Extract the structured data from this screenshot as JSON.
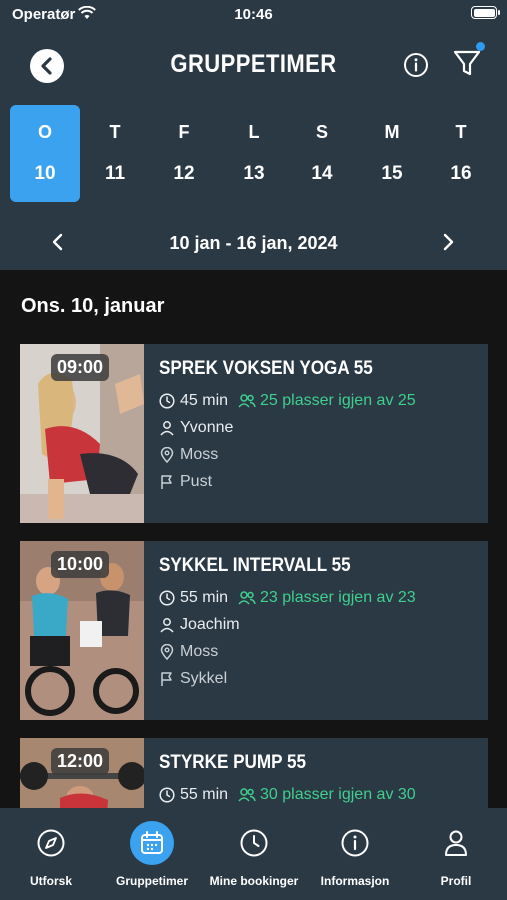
{
  "status_bar": {
    "carrier": "Operatør",
    "time": "10:46"
  },
  "header": {
    "title": "GRUPPETIMER"
  },
  "week": {
    "days": [
      {
        "letter": "O",
        "number": "10",
        "selected": true
      },
      {
        "letter": "T",
        "number": "11"
      },
      {
        "letter": "F",
        "number": "12"
      },
      {
        "letter": "L",
        "number": "13"
      },
      {
        "letter": "S",
        "number": "14"
      },
      {
        "letter": "M",
        "number": "15"
      },
      {
        "letter": "T",
        "number": "16"
      }
    ],
    "range_label": "10 jan - 16 jan, 2024"
  },
  "list": {
    "date_heading": "Ons. 10, januar",
    "classes": [
      {
        "time": "09:00",
        "title": "SPREK VOKSEN YOGA 55",
        "duration": "45 min",
        "availability": "25 plasser igjen av 25",
        "instructor": "Yvonne",
        "location": "Moss",
        "category": "Pust"
      },
      {
        "time": "10:00",
        "title": "SYKKEL INTERVALL 55",
        "duration": "55 min",
        "availability": "23 plasser igjen av 23",
        "instructor": "Joachim",
        "location": "Moss",
        "category": "Sykkel"
      },
      {
        "time": "12:00",
        "title": "STYRKE PUMP 55",
        "duration": "55 min",
        "availability": "30 plasser igjen av 30",
        "instructor": "",
        "location": "",
        "category": ""
      }
    ]
  },
  "tabbar": {
    "tabs": [
      {
        "label": "Utforsk",
        "icon": "compass-icon"
      },
      {
        "label": "Gruppetimer",
        "icon": "calendar-icon",
        "active": true
      },
      {
        "label": "Mine bookinger",
        "icon": "clock-icon"
      },
      {
        "label": "Informasjon",
        "icon": "info-icon"
      },
      {
        "label": "Profil",
        "icon": "person-icon"
      }
    ]
  },
  "colors": {
    "header_bg": "#2b3944",
    "accent": "#3aa2ef",
    "availability": "#3fcf8e",
    "page_bg": "#141414"
  }
}
